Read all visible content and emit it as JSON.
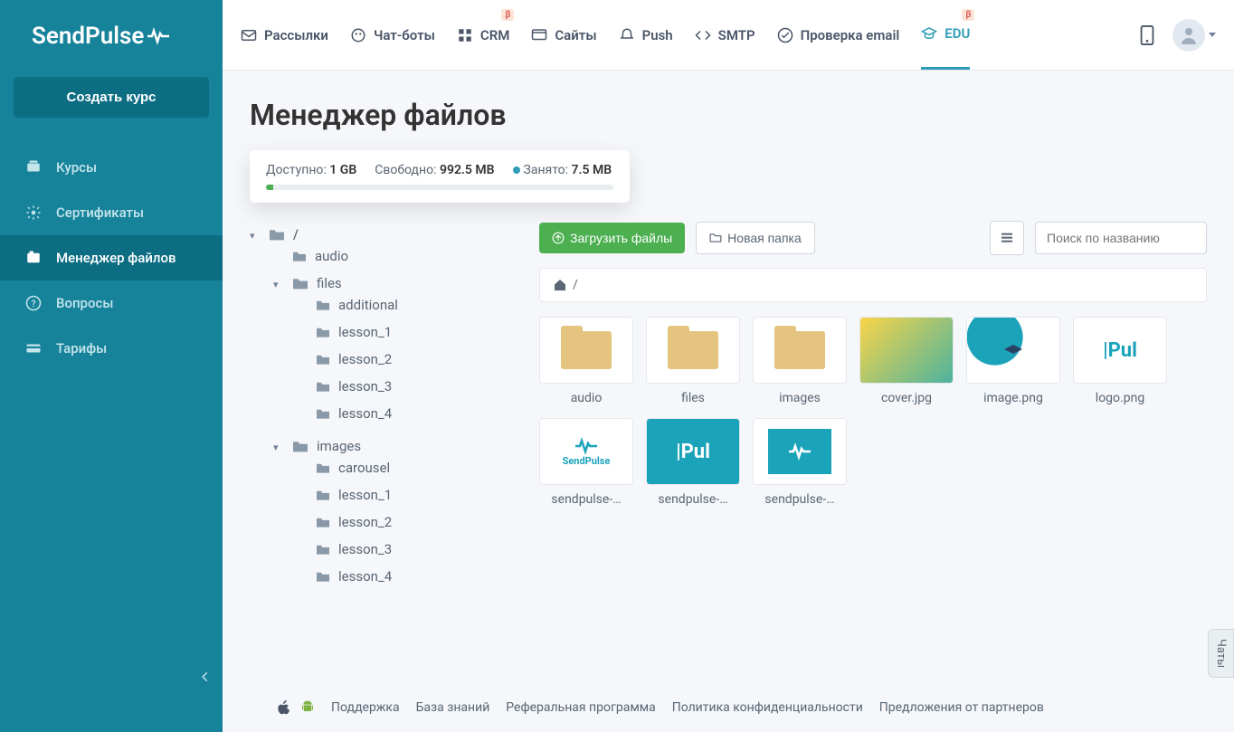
{
  "logo": "SendPulse",
  "sidebar": {
    "create_btn": "Создать курс",
    "items": [
      {
        "label": "Курсы"
      },
      {
        "label": "Сертификаты"
      },
      {
        "label": "Менеджер файлов"
      },
      {
        "label": "Вопросы"
      },
      {
        "label": "Тарифы"
      }
    ]
  },
  "topnav": {
    "items": [
      {
        "label": "Рассылки"
      },
      {
        "label": "Чат-боты"
      },
      {
        "label": "CRM",
        "beta": "β"
      },
      {
        "label": "Сайты"
      },
      {
        "label": "Push"
      },
      {
        "label": "SMTP"
      },
      {
        "label": "Проверка email"
      },
      {
        "label": "EDU",
        "beta": "β"
      }
    ]
  },
  "page_title": "Менеджер файлов",
  "storage": {
    "available_label": "Доступно:",
    "available_value": "1 GB",
    "free_label": "Свободно:",
    "free_value": "992.5 MB",
    "used_label": "Занято:",
    "used_value": "7.5 MB"
  },
  "tree": {
    "root": "/",
    "audio": "audio",
    "files": "files",
    "additional": "additional",
    "lesson_1": "lesson_1",
    "lesson_2": "lesson_2",
    "lesson_3": "lesson_3",
    "lesson_4": "lesson_4",
    "images": "images",
    "carousel": "carousel"
  },
  "toolbar": {
    "upload": "Загрузить файлы",
    "new_folder": "Новая папка",
    "search_placeholder": "Поиск по названию"
  },
  "breadcrumb": {
    "sep": "/"
  },
  "files": {
    "audio": "audio",
    "files_folder": "files",
    "images": "images",
    "cover": "cover.jpg",
    "image": "image.png",
    "logo": "logo.png",
    "sp1": "sendpulse-…",
    "sp2": "sendpulse-…",
    "sp3": "sendpulse-…"
  },
  "footer": {
    "support": "Поддержка",
    "kb": "База знаний",
    "referral": "Реферальная программа",
    "privacy": "Политика конфиденциальности",
    "partners": "Предложения от партнеров"
  },
  "chat_tab": "Чаты"
}
